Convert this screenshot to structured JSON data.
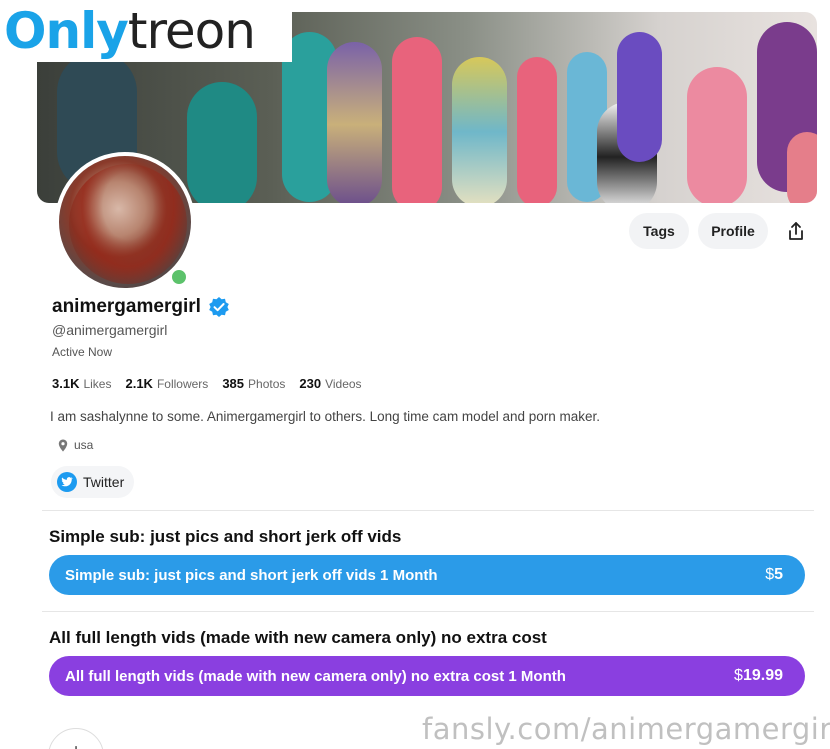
{
  "watermark": {
    "logo_part1": "Only",
    "logo_part2": "treon",
    "footer": "fansly.com/animergamergirl"
  },
  "profile": {
    "name": "animergamergirl",
    "handle": "@animergamergirl",
    "status": "Active Now",
    "bio": "I am sashalynne to some. Animergamergirl to others. Long time cam model and porn maker.",
    "location": "usa"
  },
  "actions": {
    "tags": "Tags",
    "profile": "Profile"
  },
  "stats": [
    {
      "value": "3.1K",
      "label": "Likes"
    },
    {
      "value": "2.1K",
      "label": "Followers"
    },
    {
      "value": "385",
      "label": "Photos"
    },
    {
      "value": "230",
      "label": "Videos"
    }
  ],
  "social": {
    "twitter": "Twitter"
  },
  "tiers": [
    {
      "title": "Simple sub: just pics and short jerk off vids",
      "button_label": "Simple sub: just pics and short jerk off vids 1 Month",
      "currency": "$",
      "price": "5",
      "color": "#2b9be8"
    },
    {
      "title": "All full length vids (made with new camera only) no extra cost",
      "button_label": "All full length vids (made with new camera only) no extra cost 1 Month",
      "currency": "$",
      "price": "19.99",
      "color": "#8a3fe0"
    }
  ],
  "colors": {
    "online": "#5cc26b",
    "verified": "#1d9bf0",
    "twitter": "#1d9bf0"
  },
  "icons": [
    "verified-icon",
    "share-icon",
    "location-pin-icon",
    "twitter-icon",
    "plus-icon"
  ]
}
